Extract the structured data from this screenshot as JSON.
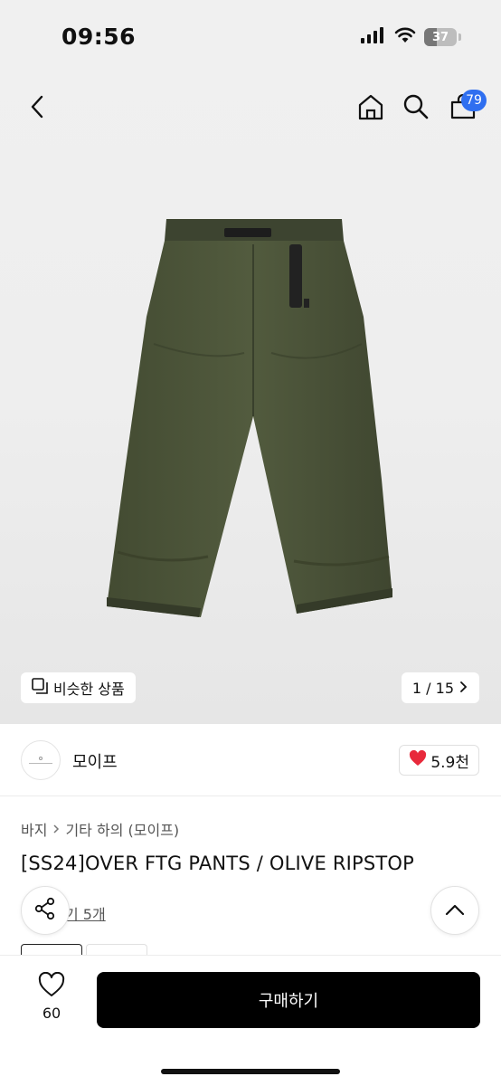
{
  "status_bar": {
    "time": "09:56",
    "battery": "37",
    "icons": [
      "signal-icon",
      "wifi-icon",
      "battery-icon"
    ]
  },
  "nav": {
    "icons": [
      "back-icon",
      "home-icon",
      "search-icon",
      "cart-icon"
    ],
    "cart_count": "79",
    "badge_color": "#2f6ff0"
  },
  "gallery": {
    "similar_label": "비슷한 상품",
    "page_indicator": "1 / 15",
    "product_color": "#4a5238"
  },
  "seller": {
    "name": "모이프",
    "likes": "5.9천",
    "like_color": "#e8293b"
  },
  "product": {
    "breadcrumb": [
      "바지",
      "기타 하의 (모이프)"
    ],
    "title": "[SS24]OVER FTG PANTS / OLIVE RIPSTOP",
    "review_link": "기 5개"
  },
  "bottom_bar": {
    "wish_count": "60",
    "buy_label": "구매하기"
  }
}
